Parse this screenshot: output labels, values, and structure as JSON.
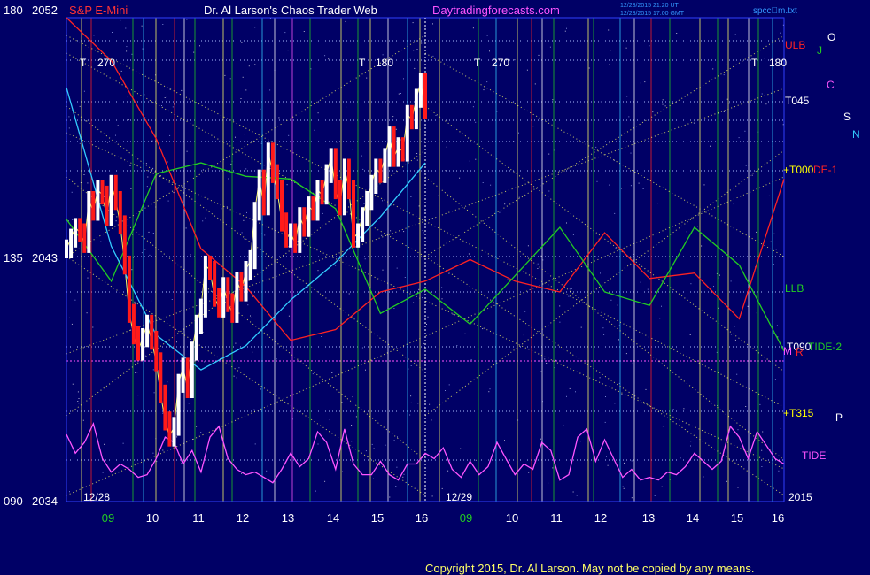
{
  "header": {
    "instrument": "S&P E-Mini",
    "title": "Dr. Al Larson's Chaos Trader Web",
    "site": "Daytradingforecasts.com",
    "timestamp_1": "12/28/2015 21:20 UT",
    "timestamp_2": "12/28/2015 17:00 GMT",
    "filename": "spcc\u0000m.txt"
  },
  "copyright": "Copyright 2015, Dr. Al Larson. May not be copied by any means.",
  "colors": {
    "background": "#000066",
    "axis": "#2f3fff",
    "price_bars": "#ffffff",
    "down_bars": "#ff1a1a",
    "tide": "#ff55ff",
    "planet_red": "#ff2222",
    "planet_green": "#22cc22",
    "planet_cyan": "#33ccff",
    "grid_yellow": "#ffff66"
  },
  "chart_data": {
    "type": "line",
    "title": "S&P E-Mini",
    "y_axis": {
      "ticks": [
        {
          "angle": "180",
          "price": "2052"
        },
        {
          "angle": "135",
          "price": "2043"
        },
        {
          "angle": "090",
          "price": "2034"
        }
      ],
      "ylim": [
        2034,
        2052
      ]
    },
    "x_axis": {
      "date_labels": [
        "12/28",
        "12/29"
      ],
      "year_label": "2015",
      "hour_ticks": [
        "09",
        "10",
        "11",
        "12",
        "13",
        "14",
        "15",
        "16",
        "09",
        "10",
        "11",
        "12",
        "13",
        "14",
        "15",
        "16"
      ]
    },
    "right_labels": [
      {
        "text": "ULB",
        "color": "#ff2222"
      },
      {
        "text": "T045",
        "color": "#ffffff"
      },
      {
        "text": "+T000",
        "color": "#ffff00"
      },
      {
        "text": "DE-1",
        "color": "#ff2222"
      },
      {
        "text": "LLB",
        "color": "#22cc22"
      },
      {
        "text": "T090",
        "color": "#ffffff"
      },
      {
        "text": "TIDE-2",
        "color": "#22cc22"
      },
      {
        "text": "+T315",
        "color": "#ffff00"
      },
      {
        "text": "TIDE",
        "color": "#ff55ff"
      }
    ],
    "planet_glyphs": [
      {
        "text": "O",
        "color": "#ffffff"
      },
      {
        "text": "J",
        "color": "#22cc22"
      },
      {
        "text": "C",
        "color": "#ff55ff"
      },
      {
        "text": "S",
        "color": "#ffffff"
      },
      {
        "text": "N",
        "color": "#33ccff"
      },
      {
        "text": "P",
        "color": "#ffffff"
      },
      {
        "text": "M",
        "color": "#ff55ff"
      },
      {
        "text": "R",
        "color": "#ff2222"
      }
    ],
    "time_markers": [
      {
        "text": "T",
        "angle": "270"
      },
      {
        "text": "T",
        "angle": "180"
      },
      {
        "text": "T",
        "angle": "270"
      },
      {
        "text": "T",
        "angle": "180"
      }
    ],
    "series": [
      {
        "name": "price",
        "x": [
          0,
          1,
          2,
          3,
          4,
          5,
          6,
          7,
          8,
          9,
          10,
          11,
          12,
          13,
          14,
          15,
          16,
          17,
          18,
          19,
          20,
          21,
          22,
          23,
          24,
          25,
          26,
          27,
          28,
          29,
          30,
          31,
          32,
          33,
          34,
          35,
          36,
          37,
          38,
          39,
          40,
          41,
          42,
          43,
          44,
          45,
          46,
          47,
          48,
          49,
          50,
          51,
          52,
          53,
          54,
          55,
          56,
          57,
          58,
          59,
          60,
          61,
          62,
          63,
          64,
          65,
          66,
          67,
          68,
          69,
          70,
          71,
          72,
          73,
          74,
          75,
          76,
          77,
          78,
          79,
          80
        ],
        "values": [
          2043.4,
          2043.8,
          2044.2,
          2044.0,
          2043.6,
          2045.2,
          2044.8,
          2045.6,
          2045.4,
          2044.6,
          2045.8,
          2045.2,
          2044.3,
          2042.8,
          2041.0,
          2040.2,
          2039.6,
          2040.1,
          2040.6,
          2040.0,
          2039.2,
          2038.0,
          2037.0,
          2036.4,
          2036.8,
          2038.4,
          2039.0,
          2038.2,
          2039.6,
          2040.6,
          2041.2,
          2042.8,
          2042.6,
          2041.6,
          2041.2,
          2042.0,
          2041.4,
          2041.0,
          2042.2,
          2041.8,
          2042.6,
          2043.0,
          2044.8,
          2046.0,
          2045.0,
          2047.0,
          2046.2,
          2045.6,
          2044.4,
          2043.8,
          2044.0,
          2043.6,
          2044.6,
          2044.2,
          2045.0,
          2044.8,
          2045.6,
          2045.4,
          2046.2,
          2046.8,
          2045.6,
          2045.0,
          2046.4,
          2045.6,
          2043.8,
          2044.0,
          2044.6,
          2045.2,
          2045.8,
          2046.4,
          2046.2,
          2046.8,
          2047.6,
          2046.8,
          2047.2,
          2047.0,
          2048.4,
          2048.2,
          2049.0,
          2049.6,
          2048.6
        ]
      },
      {
        "name": "tide",
        "x": [
          0,
          2,
          4,
          6,
          8,
          10,
          12,
          14,
          16,
          18,
          20,
          22,
          24,
          26,
          28,
          30,
          32,
          34,
          36,
          38,
          40,
          42,
          44,
          46,
          48,
          50,
          52,
          54,
          56,
          58,
          60,
          62,
          64,
          66,
          68,
          70,
          72,
          74,
          76,
          78,
          80,
          82,
          84,
          86,
          88,
          90,
          92,
          94,
          96,
          98,
          100,
          102,
          104,
          106,
          108,
          110,
          112,
          114,
          116,
          118,
          120,
          122,
          124,
          126,
          128,
          130,
          132,
          134,
          136,
          138,
          140,
          142,
          144,
          146,
          148,
          150,
          152,
          154,
          156,
          158,
          160
        ],
        "values": [
          2036.5,
          2035.8,
          2036.2,
          2036.9,
          2035.6,
          2035.1,
          2035.4,
          2035.2,
          2034.9,
          2035.0,
          2035.6,
          2036.4,
          2036.2,
          2035.4,
          2035.9,
          2035.1,
          2036.4,
          2036.8,
          2035.6,
          2035.2,
          2035.0,
          2035.1,
          2034.9,
          2034.7,
          2035.2,
          2035.8,
          2035.3,
          2035.6,
          2036.6,
          2036.2,
          2035.2,
          2036.7,
          2035.4,
          2035.0,
          2035.0,
          2035.5,
          2035.0,
          2034.8,
          2035.4,
          2035.4,
          2035.8,
          2035.6,
          2036.0,
          2035.2,
          2034.9,
          2035.5,
          2035.0,
          2035.3,
          2036.2,
          2035.6,
          2035.0,
          2035.4,
          2035.2,
          2036.2,
          2035.9,
          2034.8,
          2035.0,
          2036.4,
          2036.7,
          2035.5,
          2036.3,
          2035.6,
          2034.9,
          2035.2,
          2034.8,
          2034.9,
          2034.8,
          2035.1,
          2035.0,
          2035.3,
          2035.8,
          2035.5,
          2035.2,
          2035.5,
          2036.8,
          2036.4,
          2035.6,
          2036.6,
          2036.1,
          2035.6,
          2035.4
        ]
      },
      {
        "name": "red-envelope",
        "x": [
          0,
          10,
          20,
          30,
          40,
          50,
          60,
          70,
          80,
          90,
          100,
          110,
          120,
          130,
          140,
          150,
          160
        ],
        "values": [
          2052.0,
          2050.4,
          2047.5,
          2043.4,
          2042.0,
          2040.0,
          2040.4,
          2041.8,
          2042.2,
          2043.0,
          2042.2,
          2041.8,
          2044.0,
          2042.3,
          2042.5,
          2040.8,
          2046.0
        ]
      },
      {
        "name": "green-envelope",
        "x": [
          0,
          10,
          20,
          30,
          40,
          50,
          60,
          70,
          80,
          90,
          100,
          110,
          120,
          130,
          140,
          150,
          160
        ],
        "values": [
          2044.5,
          2042.2,
          2046.2,
          2046.6,
          2046.1,
          2046.0,
          2044.9,
          2041.0,
          2041.9,
          2040.6,
          2042.4,
          2044.2,
          2041.8,
          2041.3,
          2044.2,
          2042.8,
          2039.6
        ]
      },
      {
        "name": "cyan-envelope",
        "x": [
          0,
          10,
          20,
          30,
          40,
          50,
          60,
          70,
          80
        ],
        "values": [
          2049.4,
          2043.5,
          2040.2,
          2038.9,
          2039.8,
          2041.5,
          2042.9,
          2044.6,
          2046.6
        ]
      }
    ]
  }
}
